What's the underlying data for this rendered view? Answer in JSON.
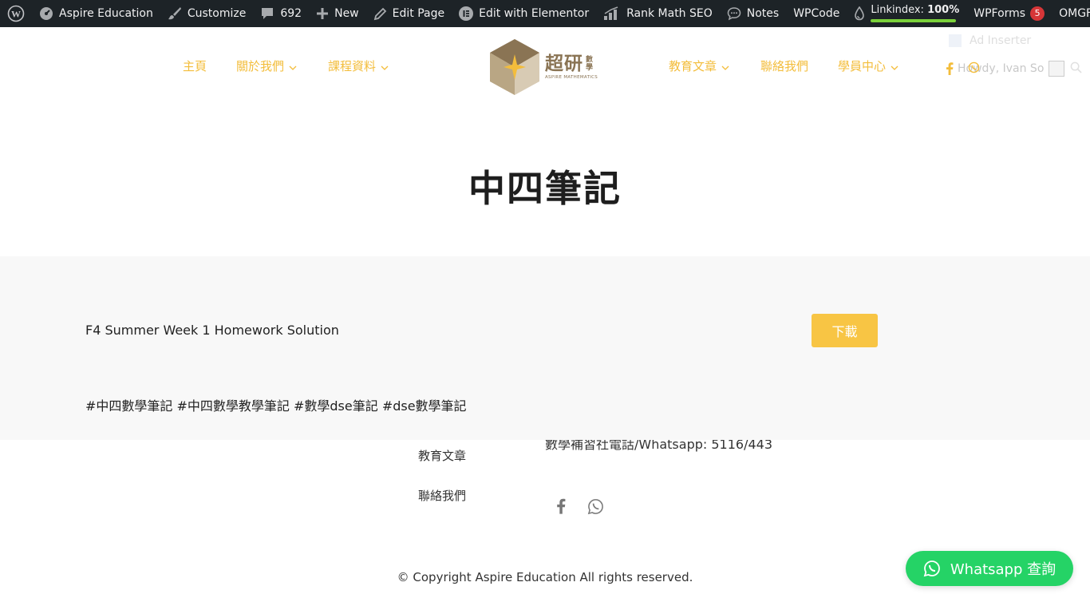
{
  "admin_bar": {
    "site_name": "Aspire Education",
    "customize": "Customize",
    "comments_count": "692",
    "new_label": "New",
    "edit_page": "Edit Page",
    "edit_elementor": "Edit with Elementor",
    "rank_math": "Rank Math SEO",
    "notes": "Notes",
    "wpcode": "WPCode",
    "linkindex_label": "Linkindex:",
    "linkindex_value": "100%",
    "linkindex_progress": 1.0,
    "wpforms": "WPForms",
    "wpforms_count": "5",
    "omgf": "OMGF"
  },
  "header": {
    "nav_left": [
      "主頁",
      "關於我們",
      "課程資料"
    ],
    "nav_right": [
      "教育文章",
      "聯絡我們",
      "學員中心"
    ],
    "logo_cn": "超研",
    "logo_cn_small": "數學",
    "logo_en": "ASPIRE MATHEMATICS",
    "howdy": "Howdy, Ivan So",
    "ad_inserter": "Ad Inserter",
    "accent_color": "#f3bd3b"
  },
  "page": {
    "title": "中四筆記"
  },
  "content": {
    "file_title": "F4 Summer Week 1 Homework Solution",
    "download_label": "下載",
    "tags": "#中四數學筆記 #中四數學教學筆記 #數學dse筆記 #dse數學筆記"
  },
  "footer": {
    "links": [
      "教育文章",
      "聯絡我們"
    ],
    "contact": "數學補習社電話/Whatsapp: 5116/443",
    "copyright": "© Copyright Aspire Education All rights reserved."
  },
  "whatsapp": {
    "label": "Whatsapp 查詢",
    "color": "#25d366"
  }
}
